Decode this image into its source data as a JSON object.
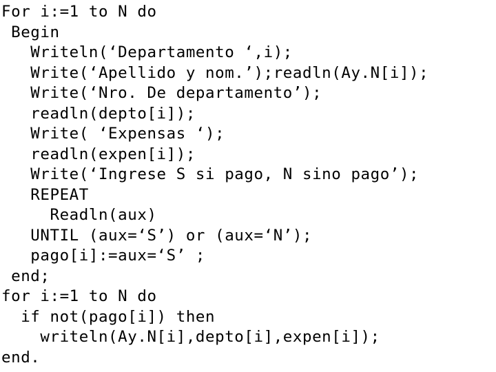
{
  "document": {
    "kind": "code-listing",
    "language": "Pascal",
    "background_color": "#ffffff",
    "text_color": "#000000",
    "line_count": 18
  },
  "code": {
    "lines": [
      "For i:=1 to N do",
      " Begin",
      "   Writeln(‘Departamento ‘,i);",
      "   Write(‘Apellido y nom.’);readln(Ay.N[i]);",
      "   Write(‘Nro. De departamento’);",
      "   readln(depto[i]);",
      "   Write( ‘Expensas ‘);",
      "   readln(expen[i]);",
      "   Write(‘Ingrese S si pago, N sino pago’);",
      "   REPEAT",
      "     Readln(aux)",
      "   UNTIL (aux=‘S’) or (aux=‘N’);",
      "   pago[i]:=aux=‘S’ ;",
      " end;",
      "for i:=1 to N do",
      "  if not(pago[i]) then",
      "    writeln(Ay.N[i],depto[i],expen[i]);",
      "end."
    ]
  }
}
